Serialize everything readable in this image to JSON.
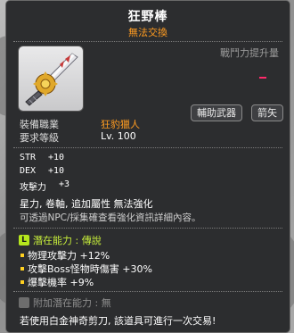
{
  "item": {
    "name": "狂野棒",
    "trade_status": "無法交換",
    "power_label": "戰鬥力提升量",
    "job_label": "裝備職業",
    "job_value": "狂豹獵人",
    "level_label": "要求等級",
    "level_value": "Lv. 100",
    "tags": [
      "輔助武器",
      "箭矢"
    ],
    "icon": "wild-arrow-icon",
    "stats": [
      {
        "name": "STR",
        "value": "+10"
      },
      {
        "name": "DEX",
        "value": "+10"
      },
      {
        "name": "攻擊力",
        "value": "+3"
      }
    ],
    "desc_line1": "星力, 卷軸, 追加屬性 無法強化",
    "desc_line2": "可透過NPC/採集確查看強化資訊詳細內容。",
    "potential": {
      "badge": "L",
      "label": "潛在能力 : 傳說",
      "lines": [
        "物理攻擊力 +12%",
        "攻擊Boss怪物時傷害 +30%",
        "爆擊機率 +9%"
      ]
    },
    "additional_potential_label": "附加潛在能力 : 無",
    "footer_text": "若使用白金神奇剪刀, 該道具可進行一次交易!"
  },
  "colors": {
    "panel": "#2c2d2f",
    "trade": "#ff9c21",
    "job": "#ff9c21",
    "potential": "#c8ef3b",
    "bullet": "#ffd020",
    "power_indicator": "#ff2a6a"
  }
}
